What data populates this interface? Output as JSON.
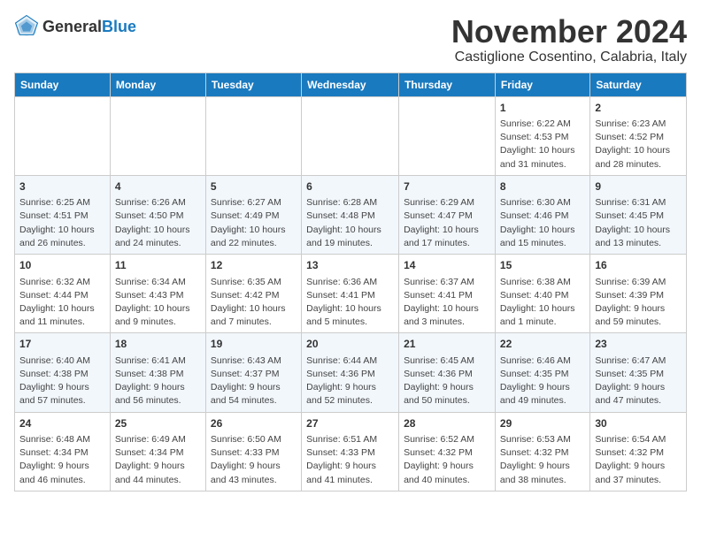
{
  "header": {
    "logo_general": "General",
    "logo_blue": "Blue",
    "month": "November 2024",
    "location": "Castiglione Cosentino, Calabria, Italy"
  },
  "days_of_week": [
    "Sunday",
    "Monday",
    "Tuesday",
    "Wednesday",
    "Thursday",
    "Friday",
    "Saturday"
  ],
  "weeks": [
    [
      {
        "day": "",
        "detail": ""
      },
      {
        "day": "",
        "detail": ""
      },
      {
        "day": "",
        "detail": ""
      },
      {
        "day": "",
        "detail": ""
      },
      {
        "day": "",
        "detail": ""
      },
      {
        "day": "1",
        "detail": "Sunrise: 6:22 AM\nSunset: 4:53 PM\nDaylight: 10 hours and 31 minutes."
      },
      {
        "day": "2",
        "detail": "Sunrise: 6:23 AM\nSunset: 4:52 PM\nDaylight: 10 hours and 28 minutes."
      }
    ],
    [
      {
        "day": "3",
        "detail": "Sunrise: 6:25 AM\nSunset: 4:51 PM\nDaylight: 10 hours and 26 minutes."
      },
      {
        "day": "4",
        "detail": "Sunrise: 6:26 AM\nSunset: 4:50 PM\nDaylight: 10 hours and 24 minutes."
      },
      {
        "day": "5",
        "detail": "Sunrise: 6:27 AM\nSunset: 4:49 PM\nDaylight: 10 hours and 22 minutes."
      },
      {
        "day": "6",
        "detail": "Sunrise: 6:28 AM\nSunset: 4:48 PM\nDaylight: 10 hours and 19 minutes."
      },
      {
        "day": "7",
        "detail": "Sunrise: 6:29 AM\nSunset: 4:47 PM\nDaylight: 10 hours and 17 minutes."
      },
      {
        "day": "8",
        "detail": "Sunrise: 6:30 AM\nSunset: 4:46 PM\nDaylight: 10 hours and 15 minutes."
      },
      {
        "day": "9",
        "detail": "Sunrise: 6:31 AM\nSunset: 4:45 PM\nDaylight: 10 hours and 13 minutes."
      }
    ],
    [
      {
        "day": "10",
        "detail": "Sunrise: 6:32 AM\nSunset: 4:44 PM\nDaylight: 10 hours and 11 minutes."
      },
      {
        "day": "11",
        "detail": "Sunrise: 6:34 AM\nSunset: 4:43 PM\nDaylight: 10 hours and 9 minutes."
      },
      {
        "day": "12",
        "detail": "Sunrise: 6:35 AM\nSunset: 4:42 PM\nDaylight: 10 hours and 7 minutes."
      },
      {
        "day": "13",
        "detail": "Sunrise: 6:36 AM\nSunset: 4:41 PM\nDaylight: 10 hours and 5 minutes."
      },
      {
        "day": "14",
        "detail": "Sunrise: 6:37 AM\nSunset: 4:41 PM\nDaylight: 10 hours and 3 minutes."
      },
      {
        "day": "15",
        "detail": "Sunrise: 6:38 AM\nSunset: 4:40 PM\nDaylight: 10 hours and 1 minute."
      },
      {
        "day": "16",
        "detail": "Sunrise: 6:39 AM\nSunset: 4:39 PM\nDaylight: 9 hours and 59 minutes."
      }
    ],
    [
      {
        "day": "17",
        "detail": "Sunrise: 6:40 AM\nSunset: 4:38 PM\nDaylight: 9 hours and 57 minutes."
      },
      {
        "day": "18",
        "detail": "Sunrise: 6:41 AM\nSunset: 4:38 PM\nDaylight: 9 hours and 56 minutes."
      },
      {
        "day": "19",
        "detail": "Sunrise: 6:43 AM\nSunset: 4:37 PM\nDaylight: 9 hours and 54 minutes."
      },
      {
        "day": "20",
        "detail": "Sunrise: 6:44 AM\nSunset: 4:36 PM\nDaylight: 9 hours and 52 minutes."
      },
      {
        "day": "21",
        "detail": "Sunrise: 6:45 AM\nSunset: 4:36 PM\nDaylight: 9 hours and 50 minutes."
      },
      {
        "day": "22",
        "detail": "Sunrise: 6:46 AM\nSunset: 4:35 PM\nDaylight: 9 hours and 49 minutes."
      },
      {
        "day": "23",
        "detail": "Sunrise: 6:47 AM\nSunset: 4:35 PM\nDaylight: 9 hours and 47 minutes."
      }
    ],
    [
      {
        "day": "24",
        "detail": "Sunrise: 6:48 AM\nSunset: 4:34 PM\nDaylight: 9 hours and 46 minutes."
      },
      {
        "day": "25",
        "detail": "Sunrise: 6:49 AM\nSunset: 4:34 PM\nDaylight: 9 hours and 44 minutes."
      },
      {
        "day": "26",
        "detail": "Sunrise: 6:50 AM\nSunset: 4:33 PM\nDaylight: 9 hours and 43 minutes."
      },
      {
        "day": "27",
        "detail": "Sunrise: 6:51 AM\nSunset: 4:33 PM\nDaylight: 9 hours and 41 minutes."
      },
      {
        "day": "28",
        "detail": "Sunrise: 6:52 AM\nSunset: 4:32 PM\nDaylight: 9 hours and 40 minutes."
      },
      {
        "day": "29",
        "detail": "Sunrise: 6:53 AM\nSunset: 4:32 PM\nDaylight: 9 hours and 38 minutes."
      },
      {
        "day": "30",
        "detail": "Sunrise: 6:54 AM\nSunset: 4:32 PM\nDaylight: 9 hours and 37 minutes."
      }
    ]
  ]
}
